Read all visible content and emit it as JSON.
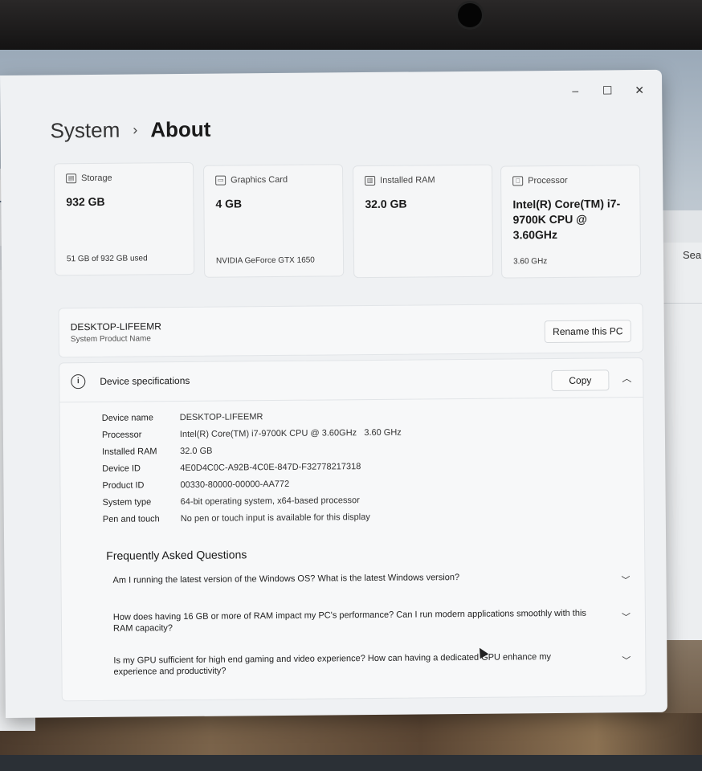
{
  "breadcrumb": {
    "parent": "System",
    "separator": "›",
    "current": "About"
  },
  "window_controls": {
    "minimize": "–",
    "maximize": "☐",
    "close": "✕"
  },
  "cards": [
    {
      "icon": "storage-icon",
      "title": "Storage",
      "value": "932 GB",
      "sub": "51 GB of 932 GB used"
    },
    {
      "icon": "graphics-card-icon",
      "title": "Graphics Card",
      "value": "4 GB",
      "sub": "NVIDIA GeForce GTX 1650"
    },
    {
      "icon": "ram-icon",
      "title": "Installed RAM",
      "value": "32.0 GB",
      "sub": ""
    },
    {
      "icon": "processor-icon",
      "title": "Processor",
      "value": "Intel(R) Core(TM) i7-9700K CPU @ 3.60GHz",
      "sub": "3.60 GHz"
    }
  ],
  "pc": {
    "name": "DESKTOP-LIFEEMR",
    "label": "System Product Name",
    "rename_button": "Rename this PC"
  },
  "specs": {
    "title": "Device specifications",
    "copy_button": "Copy",
    "rows": [
      {
        "label": "Device name",
        "value": "DESKTOP-LIFEEMR"
      },
      {
        "label": "Processor",
        "value": "Intel(R) Core(TM) i7-9700K CPU @ 3.60GHz   3.60 GHz"
      },
      {
        "label": "Installed RAM",
        "value": "32.0 GB"
      },
      {
        "label": "Device ID",
        "value": "4E0D4C0C-A92B-4C0E-847D-F32778217318"
      },
      {
        "label": "Product ID",
        "value": "00330-80000-00000-AA772"
      },
      {
        "label": "System type",
        "value": "64-bit operating system, x64-based processor"
      },
      {
        "label": "Pen and touch",
        "value": "No pen or touch input is available for this display"
      }
    ]
  },
  "faq": {
    "title": "Frequently Asked Questions",
    "items": [
      "Am I running the latest version of the Windows OS? What is the latest Windows version?",
      "How does having 16 GB or more of RAM impact my PC's performance? Can I run modern applications smoothly with this RAM capacity?",
      "Is my GPU sufficient for high end gaming and video experience? How can having a dedicated GPU enhance my experience and productivity?"
    ]
  },
  "background_window": {
    "search_partial": "Sear"
  }
}
